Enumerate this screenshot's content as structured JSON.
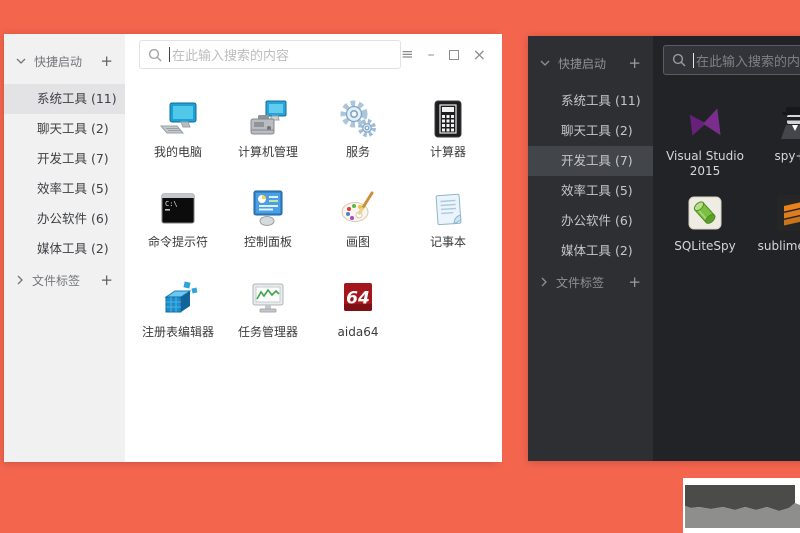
{
  "desktop": {
    "background_color": "#F4654E"
  },
  "light_window": {
    "sidebar": {
      "header": {
        "label": "快捷启动",
        "add_label": "+"
      },
      "items": [
        {
          "label": "系统工具 (11)",
          "selected": true
        },
        {
          "label": "聊天工具 (2)",
          "selected": false
        },
        {
          "label": "开发工具 (7)",
          "selected": false
        },
        {
          "label": "效率工具 (5)",
          "selected": false
        },
        {
          "label": "办公软件 (6)",
          "selected": false
        },
        {
          "label": "媒体工具 (2)",
          "selected": false
        }
      ],
      "footer": {
        "label": "文件标签",
        "add_label": "+"
      }
    },
    "search": {
      "placeholder": "在此输入搜索的内容"
    },
    "controls": {
      "menu": "≡",
      "minimize": "–",
      "close": "×"
    },
    "apps": [
      {
        "label": "我的电脑",
        "icon": "my-computer"
      },
      {
        "label": "计算机管理",
        "icon": "computer-management"
      },
      {
        "label": "服务",
        "icon": "services-gears"
      },
      {
        "label": "计算器",
        "icon": "calculator"
      },
      {
        "label": "命令提示符",
        "icon": "command-prompt"
      },
      {
        "label": "控制面板",
        "icon": "control-panel"
      },
      {
        "label": "画图",
        "icon": "paint"
      },
      {
        "label": "记事本",
        "icon": "notepad"
      },
      {
        "label": "注册表编辑器",
        "icon": "registry-editor"
      },
      {
        "label": "任务管理器",
        "icon": "task-manager"
      },
      {
        "label": "aida64",
        "icon": "aida64"
      }
    ]
  },
  "dark_window": {
    "sidebar": {
      "header": {
        "label": "快捷启动",
        "add_label": "+"
      },
      "items": [
        {
          "label": "系统工具 (11)",
          "selected": false
        },
        {
          "label": "聊天工具 (2)",
          "selected": false
        },
        {
          "label": "开发工具 (7)",
          "selected": true
        },
        {
          "label": "效率工具 (5)",
          "selected": false
        },
        {
          "label": "办公软件 (6)",
          "selected": false
        },
        {
          "label": "媒体工具 (2)",
          "selected": false
        }
      ],
      "footer": {
        "label": "文件标签",
        "add_label": "+"
      }
    },
    "search": {
      "placeholder": "在此输入搜索的内容"
    },
    "apps": [
      {
        "label": "Visual Studio 2015",
        "icon": "visual-studio"
      },
      {
        "label": "spy++",
        "icon": "spy-plus-plus"
      },
      {
        "label": "SQLiteSpy",
        "icon": "sqlitespy"
      },
      {
        "label": "sublime text",
        "icon": "sublime-text"
      }
    ]
  },
  "corner_thumbnail": {
    "colors": {
      "bg": "#ffffff",
      "dark": "#4b4b49",
      "light": "#8e8e8c"
    }
  }
}
